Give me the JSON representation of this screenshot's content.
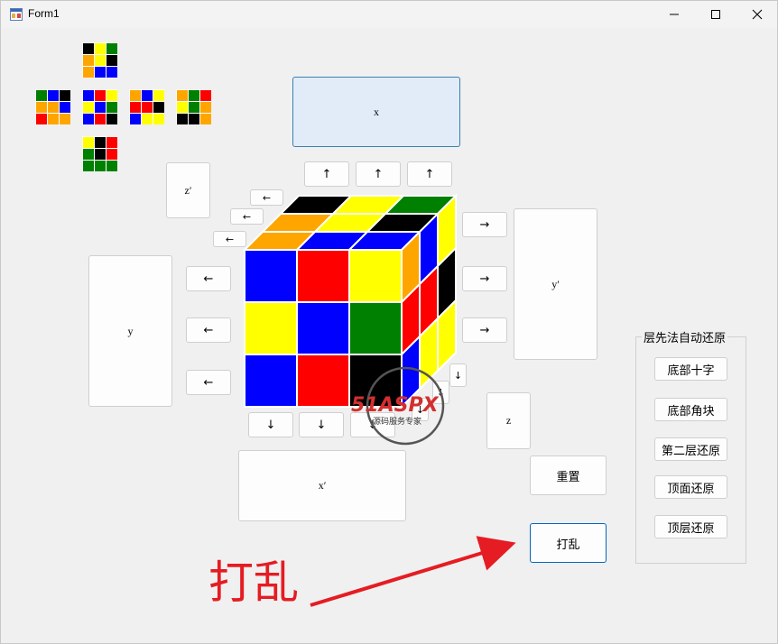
{
  "window": {
    "title": "Form1",
    "icon": "form-icon"
  },
  "controls": {
    "minimize": "minimize-icon",
    "maximize": "maximize-icon",
    "close": "close-icon"
  },
  "net": {
    "up": [
      "#000000",
      "#ffff00",
      "#008000",
      "#ffa500",
      "#ffff00",
      "#000000",
      "#ffa500",
      "#0000ff",
      "#0000ff"
    ],
    "left": [
      "#008000",
      "#0000ff",
      "#000000",
      "#ffa500",
      "#ffa500",
      "#0000ff",
      "#ff0000",
      "#ffa500",
      "#ffa500"
    ],
    "front": [
      "#0000ff",
      "#ff0000",
      "#ffff00",
      "#ffff00",
      "#0000ff",
      "#008000",
      "#0000ff",
      "#ff0000",
      "#000000"
    ],
    "right": [
      "#ffa500",
      "#0000ff",
      "#ffff00",
      "#ff0000",
      "#ff0000",
      "#000000",
      "#0000ff",
      "#ffff00",
      "#ffff00"
    ],
    "back": [
      "#ffa500",
      "#008000",
      "#ff0000",
      "#ffff00",
      "#008000",
      "#ffa500",
      "#000000",
      "#000000",
      "#ffa500"
    ],
    "down": [
      "#ffff00",
      "#000000",
      "#ff0000",
      "#008000",
      "#000000",
      "#ff0000",
      "#008000",
      "#008000",
      "#008000"
    ]
  },
  "cube": {
    "front": [
      "#0000ff",
      "#ff0000",
      "#ffff00",
      "#ffff00",
      "#0000ff",
      "#008000",
      "#0000ff",
      "#ff0000",
      "#000000"
    ],
    "top": [
      "#000000",
      "#ffff00",
      "#008000",
      "#ffa500",
      "#ffff00",
      "#000000",
      "#ffa500",
      "#0000ff",
      "#0000ff"
    ],
    "right": [
      "#ffa500",
      "#0000ff",
      "#ffff00",
      "#ff0000",
      "#ff0000",
      "#000000",
      "#0000ff",
      "#ffff00",
      "#ffff00"
    ]
  },
  "buttons": {
    "x": "x",
    "x_prime": "x′",
    "y": "y",
    "y_prime": "y′",
    "z": "z",
    "z_prime": "z′",
    "up_arrow": "↑",
    "down_arrow": "↓",
    "left_arrow": "←",
    "right_arrow": "→",
    "reset": "重置",
    "scramble": "打乱"
  },
  "group": {
    "label": "层先法自动还原",
    "items": [
      "底部十字",
      "底部角块",
      "第二层还原",
      "顶面还原",
      "顶层还原"
    ]
  },
  "annotation": {
    "label": "打乱",
    "color": "#e51c23"
  },
  "watermark": {
    "logo": "51ASPX",
    "subtitle": "源码服务专家"
  }
}
